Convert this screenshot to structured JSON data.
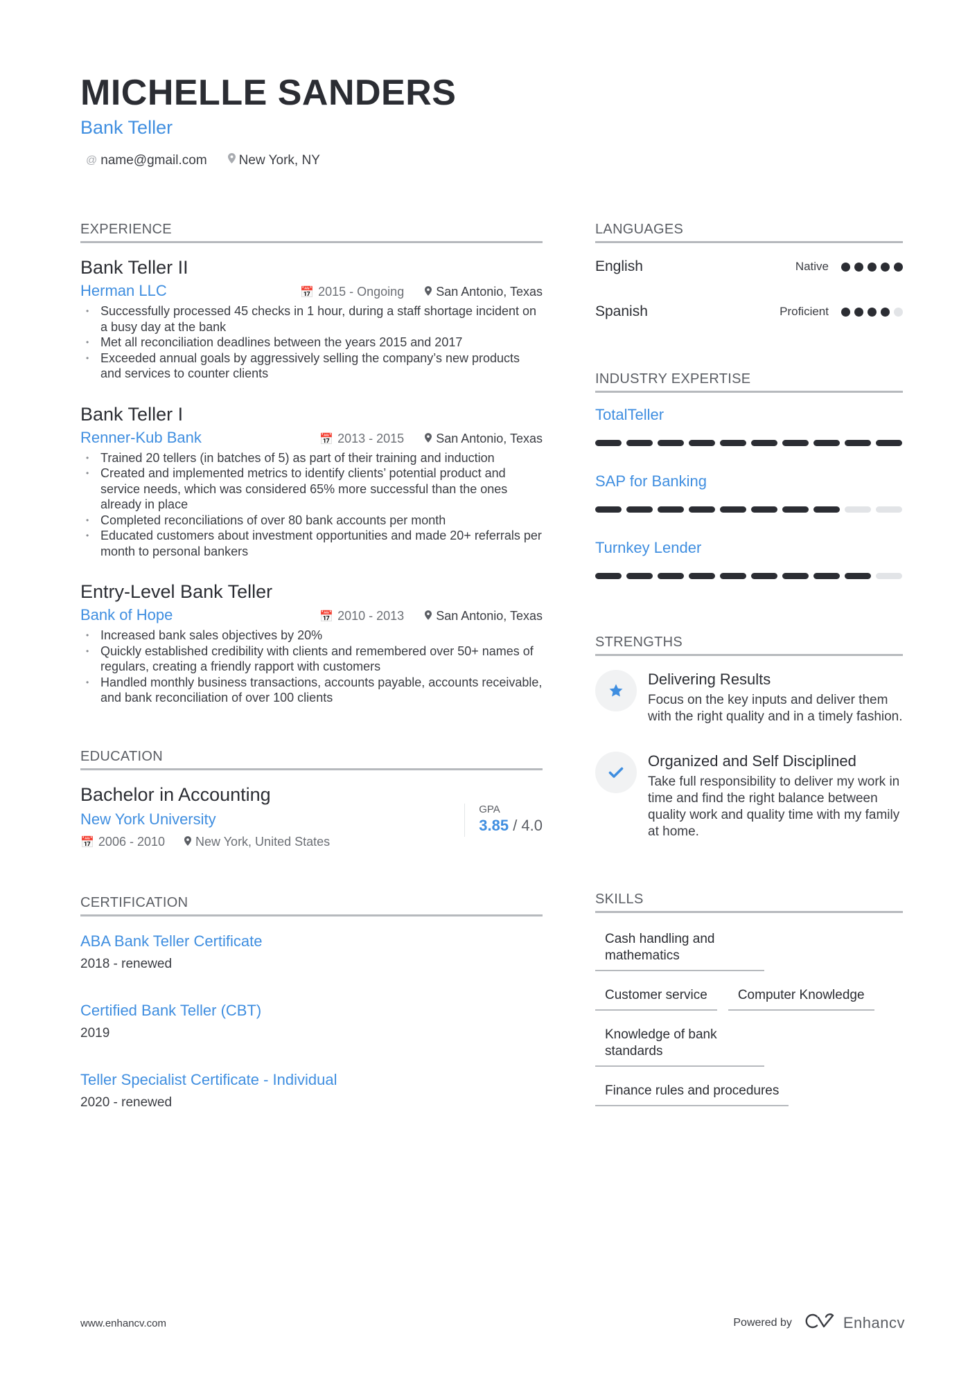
{
  "header": {
    "name": "MICHELLE SANDERS",
    "title": "Bank Teller",
    "contacts": [
      {
        "icon": "at-icon",
        "text": "name@gmail.com"
      },
      {
        "icon": "location-icon",
        "text": "New York, NY"
      }
    ]
  },
  "experience": {
    "heading": "EXPERIENCE",
    "jobs": [
      {
        "title": "Bank Teller II",
        "company": "Herman LLC",
        "dates": "2015 - Ongoing",
        "location": "San Antonio, Texas",
        "bullets": [
          "Successfully processed 45 checks in 1 hour, during a staff shortage incident on a busy day at the bank",
          "Met all reconciliation deadlines between the years 2015 and 2017",
          "Exceeded annual goals by aggressively selling the company’s new products and services to counter clients"
        ]
      },
      {
        "title": "Bank Teller I",
        "company": "Renner-Kub Bank",
        "dates": "2013 - 2015",
        "location": "San Antonio, Texas",
        "bullets": [
          "Trained 20 tellers (in batches of 5) as part of their training and induction",
          "Created and implemented metrics to identify clients’ potential product and service needs, which was considered 65% more successful than the ones already in place",
          "Completed reconciliations of over 80 bank accounts per month",
          "Educated customers about investment opportunities and made 20+ referrals per month to personal bankers"
        ]
      },
      {
        "title": "Entry-Level Bank Teller",
        "company": "Bank of Hope",
        "dates": "2010 - 2013",
        "location": "San Antonio, Texas",
        "bullets": [
          "Increased bank sales objectives by 20%",
          "Quickly established credibility with clients and remembered over 50+ names of regulars, creating a friendly rapport with customers",
          "Handled monthly business transactions, accounts payable, accounts receivable, and bank reconciliation of over 100 clients"
        ]
      }
    ]
  },
  "education": {
    "heading": "EDUCATION",
    "degree": "Bachelor in Accounting",
    "school": "New York University",
    "dates": "2006 - 2010",
    "location": "New York, United States",
    "gpa_label": "GPA",
    "gpa": "3.85",
    "gpa_max": "/ 4.0"
  },
  "certification": {
    "heading": "CERTIFICATION",
    "items": [
      {
        "name": "ABA Bank Teller Certificate",
        "year": "2018 - renewed"
      },
      {
        "name": "Certified Bank Teller (CBT)",
        "year": "2019"
      },
      {
        "name": "Teller Specialist Certificate - Individual",
        "year": "2020 - renewed"
      }
    ]
  },
  "languages": {
    "heading": "LANGUAGES",
    "items": [
      {
        "name": "English",
        "level": "Native",
        "rating": 5,
        "max": 5
      },
      {
        "name": "Spanish",
        "level": "Proficient",
        "rating": 4,
        "max": 5
      }
    ]
  },
  "expertise": {
    "heading": "INDUSTRY EXPERTISE",
    "items": [
      {
        "name": "TotalTeller",
        "rating": 10,
        "max": 10
      },
      {
        "name": "SAP for Banking",
        "rating": 8,
        "max": 10
      },
      {
        "name": "Turnkey Lender",
        "rating": 9,
        "max": 10
      }
    ]
  },
  "strengths": {
    "heading": "STRENGTHS",
    "items": [
      {
        "icon": "star-icon",
        "title": "Delivering Results",
        "description": "Focus on the key inputs and deliver them with the right quality and in a timely fashion."
      },
      {
        "icon": "checkmark-icon",
        "title": "Organized and Self Disciplined",
        "description": "Take full responsibility to deliver my work in time and find the right balance between quality work and quality time with my family at home."
      }
    ]
  },
  "skills": {
    "heading": "SKILLS",
    "items": [
      "Cash handling and mathematics",
      "Customer service",
      "Computer Knowledge",
      "Knowledge of bank standards",
      "Finance rules and procedures"
    ]
  },
  "footer": {
    "website": "www.enhancv.com",
    "powered_by": "Powered by",
    "brand": "Enhancv"
  },
  "colors": {
    "accent": "#3f8ee0",
    "text": "#2b2d33",
    "rule": "#b6b9bd",
    "inactive": "#e2e4e7"
  }
}
